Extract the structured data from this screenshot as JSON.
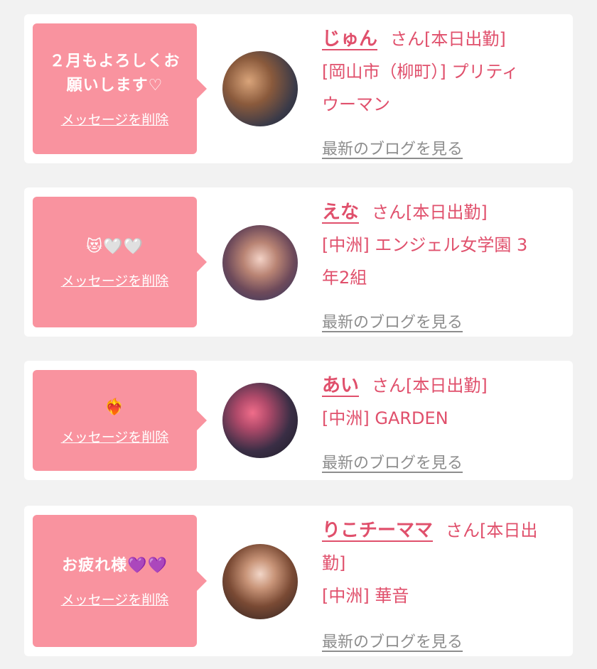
{
  "colors": {
    "accent": "#e0506c",
    "bubble": "#f9939f",
    "background": "#f2f2f2",
    "card": "#ffffff",
    "link_gray": "#8d8d8d"
  },
  "items": [
    {
      "message": "２月もよろしくお願いします♡",
      "delete_label": "メッセージを削除",
      "name": "じゅん",
      "honorific": "さん[本日出勤]",
      "shop_line1": "[岡山市（柳町）] プリティ",
      "shop_line2": "ウーマン",
      "blog_label": "最新のブログを見る",
      "avatar_icon": "profile-photo"
    },
    {
      "message": "😻🤍🤍",
      "delete_label": "メッセージを削除",
      "name": "えな",
      "honorific": "さん[本日出勤]",
      "shop_line1": "[中洲] エンジェル女学園 3",
      "shop_line2": "年2組",
      "blog_label": "最新のブログを見る",
      "avatar_icon": "profile-photo"
    },
    {
      "message": "❤️‍🔥",
      "delete_label": "メッセージを削除",
      "name": "あい",
      "honorific": "さん[本日出勤]",
      "shop_line1": "[中洲] GARDEN",
      "blog_label": "最新のブログを見る",
      "avatar_icon": "profile-photo"
    },
    {
      "message": "お疲れ様💜💜",
      "delete_label": "メッセージを削除",
      "name": "りこチーママ",
      "honorific": "さん[本日出",
      "honorific_cont": "勤]",
      "shop_line1": "[中洲] 華音",
      "blog_label": "最新のブログを見る",
      "avatar_icon": "profile-photo"
    }
  ]
}
